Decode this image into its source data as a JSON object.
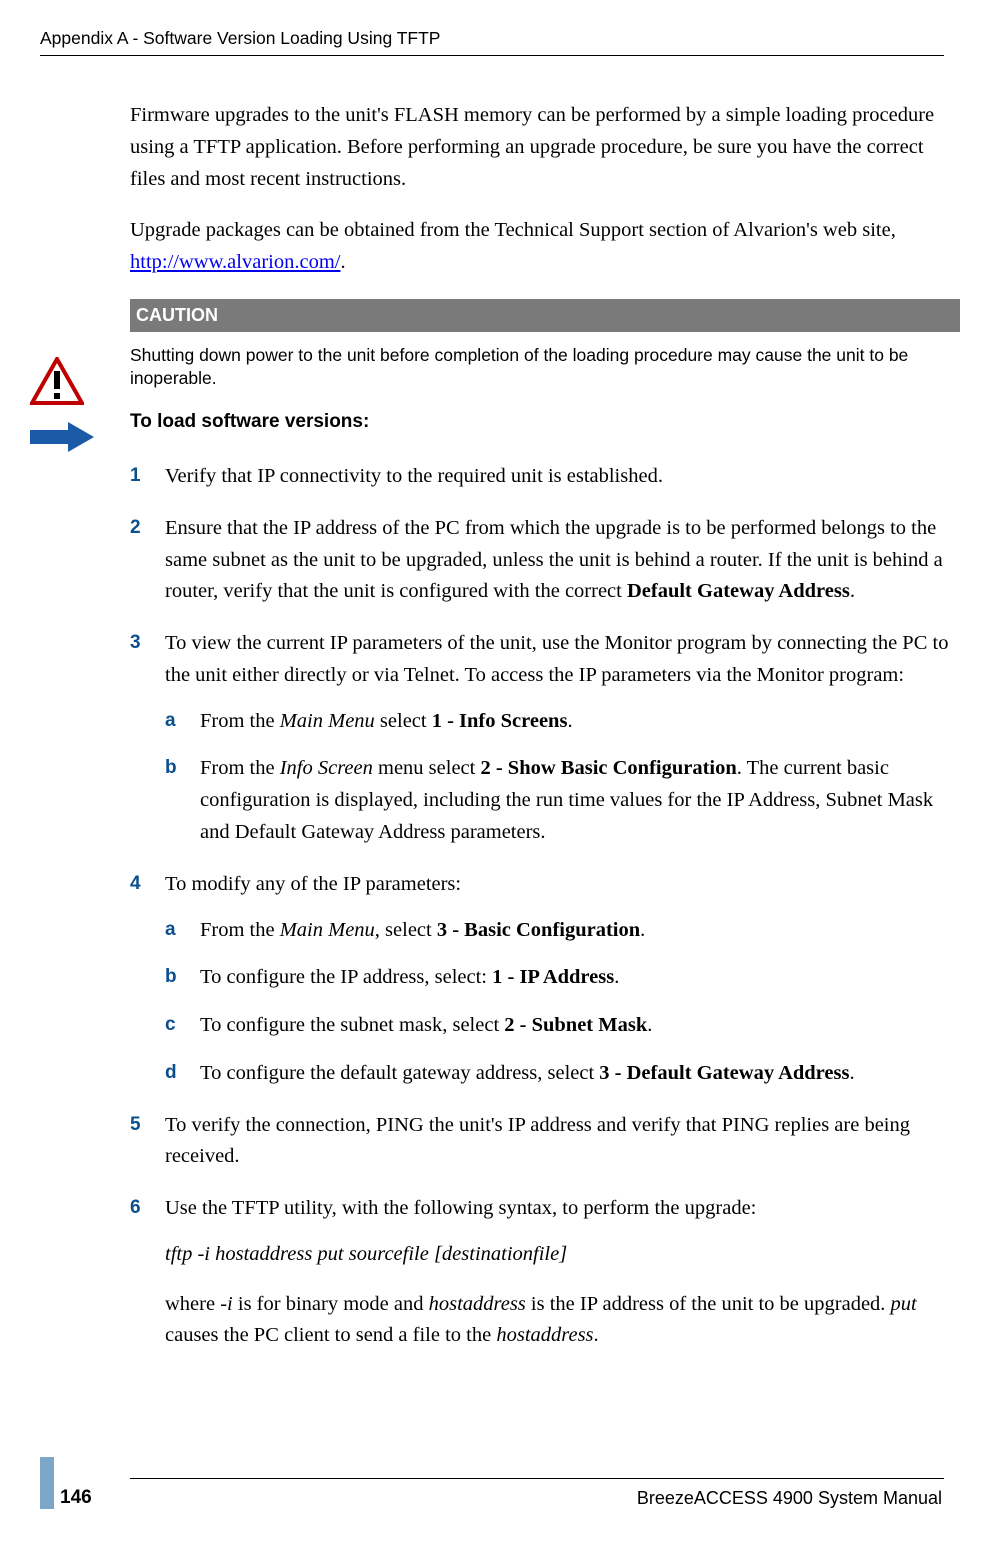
{
  "header": {
    "running_title": "Appendix A - Software Version Loading Using TFTP"
  },
  "intro": {
    "p1_a": "Firmware upgrades to the unit's FLASH memory can be performed by a simple loading procedure using a TFTP application. Before performing an upgrade procedure, be sure you have the correct files and most recent instructions.",
    "p2_prefix": "Upgrade packages can be obtained from the Technical Support section of Alvarion's web site, ",
    "p2_link": "http://www.alvarion.com/",
    "p2_suffix": "."
  },
  "caution": {
    "label": "CAUTION",
    "body": "Shutting down power to the unit before completion of the loading procedure may cause the unit to be inoperable."
  },
  "subhead": "To load software versions:",
  "steps": {
    "s1": "Verify that IP connectivity to the required unit is established.",
    "s2_a": "Ensure that the IP address of the PC from which the upgrade is to be performed belongs to the same subnet as the unit to be upgraded, unless the unit is behind a router. If the unit is behind a router, verify that the unit is configured with the correct ",
    "s2_bold": "Default Gateway Address",
    "s2_b": ".",
    "s3": "To view the current IP parameters of the unit, use the Monitor program by connecting the PC to the unit either directly or via Telnet. To access the IP parameters via the Monitor program:",
    "s3a_pre": "From the ",
    "s3a_ital": "Main Menu",
    "s3a_mid": " select ",
    "s3a_bold": "1 - Info Screens",
    "s3a_post": ".",
    "s3b_pre": "From the ",
    "s3b_ital": "Info Screen",
    "s3b_mid": " menu select ",
    "s3b_bold": "2 - Show Basic Configuration",
    "s3b_post": ". The current basic configuration is displayed, including the run time values for the IP Address, Subnet Mask and Default Gateway Address parameters.",
    "s4": "To modify any of the IP parameters:",
    "s4a_pre": "From the ",
    "s4a_ital": "Main Menu",
    "s4a_mid": ", select ",
    "s4a_bold": "3 - Basic Configuration",
    "s4a_post": ".",
    "s4b_pre": "To configure the IP address, select: ",
    "s4b_bold": "1 - IP Address",
    "s4b_post": ".",
    "s4c_pre": "To configure the subnet mask, select ",
    "s4c_bold": "2 - Subnet Mask",
    "s4c_post": ".",
    "s4d_pre": "To configure the default gateway address, select ",
    "s4d_bold": "3 - Default Gateway Address",
    "s4d_post": ".",
    "s5": "To verify the connection, PING the unit's IP address and verify that PING replies are being received.",
    "s6": "Use the TFTP utility, with the following syntax, to perform the upgrade:",
    "s6_syntax": "tftp -i hostaddress put sourcefile [destinationfile]",
    "s6_expl_a": "where ",
    "s6_expl_i1": " -i",
    "s6_expl_b": " is for binary mode and ",
    "s6_expl_i2": "hostaddress",
    "s6_expl_c": " is the IP address of the unit to be upgraded. ",
    "s6_expl_i3": "put",
    "s6_expl_d": " causes the PC client to send a file to the ",
    "s6_expl_i4": "hostaddress",
    "s6_expl_e": "."
  },
  "footer": {
    "manual": "BreezeACCESS 4900 System Manual",
    "page": "146"
  }
}
